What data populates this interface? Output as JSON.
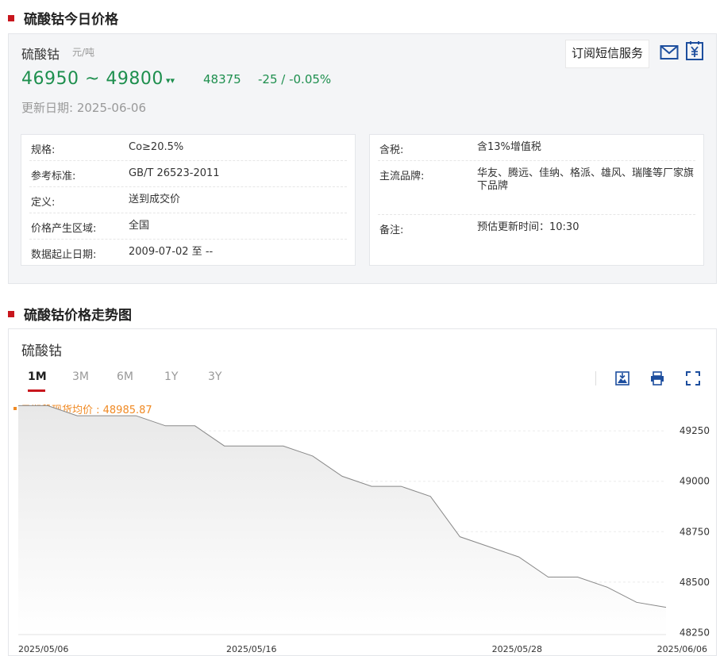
{
  "section1": {
    "title": "硫酸钴今日价格"
  },
  "price": {
    "name": "硫酸钴",
    "unit": "元/吨",
    "range": "46950 ~ 49800",
    "avg": "48375",
    "change": "-25 / -0.05%",
    "update_label": "更新日期:",
    "update_date": "2025-06-06",
    "subscribe_label": "订阅短信服务",
    "color_down": "#1e8f4e"
  },
  "info_left": [
    {
      "k": "规格:",
      "v": "Co≥20.5%"
    },
    {
      "k": "参考标准:",
      "v": "GB/T 26523-2011"
    },
    {
      "k": "定义:",
      "v": "送到成交价"
    },
    {
      "k": "价格产生区域:",
      "v": "全国"
    },
    {
      "k": "数据起止日期:",
      "v": "2009-07-02 至 --"
    }
  ],
  "info_right": [
    {
      "k": "含税:",
      "v": "含13%增值税"
    },
    {
      "k": "主流品牌:",
      "v": "华友、腾远、佳纳、格派、雄风、瑞隆等厂家旗下品牌"
    },
    {
      "k": "备注:",
      "v": "预估更新时间：10:30"
    }
  ],
  "section2": {
    "title": "硫酸钴价格走势图"
  },
  "chart": {
    "name": "硫酸钴",
    "tabs": [
      "1M",
      "3M",
      "6M",
      "1Y",
      "3Y"
    ],
    "active_tab": "1M",
    "avg_label": "日期段现货均价 : 48985.87",
    "icons": [
      "download-image-icon",
      "print-icon",
      "fullscreen-icon"
    ]
  },
  "chart_data": {
    "type": "area",
    "x": [
      "2025/05/06",
      "2025/05/07",
      "2025/05/08",
      "2025/05/09",
      "2025/05/12",
      "2025/05/13",
      "2025/05/14",
      "2025/05/15",
      "2025/05/16",
      "2025/05/19",
      "2025/05/20",
      "2025/05/21",
      "2025/05/22",
      "2025/05/23",
      "2025/05/26",
      "2025/05/27",
      "2025/05/28",
      "2025/05/29",
      "2025/06/03",
      "2025/06/04",
      "2025/06/05",
      "2025/06/06"
    ],
    "series": [
      {
        "values": [
          49375,
          49375,
          49325,
          49325,
          49325,
          49275,
          49275,
          49175,
          49175,
          49175,
          49125,
          49025,
          48975,
          48975,
          48925,
          48725,
          48675,
          48625,
          48525,
          48525,
          48475,
          48400,
          48375
        ]
      }
    ],
    "xticks": [
      "2025/05/06",
      "2025/05/16",
      "2025/05/28",
      "2025/06/06"
    ],
    "yticks": [
      48250,
      48500,
      48750,
      49000,
      49250
    ],
    "ylim": [
      48240,
      49400
    ],
    "grid": true,
    "line_color": "#888888",
    "fill_color": "#e8e8e8"
  }
}
